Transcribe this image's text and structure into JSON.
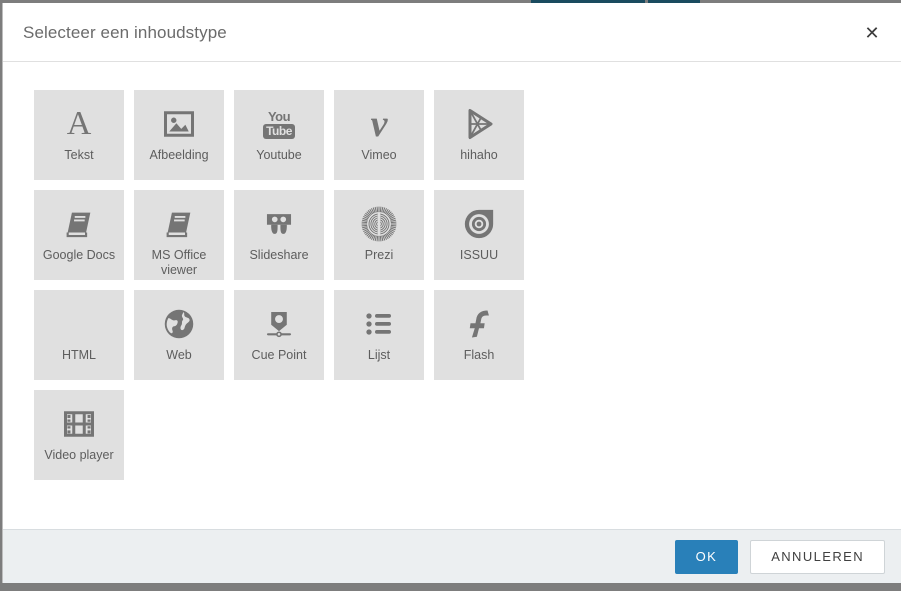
{
  "backdrop": {
    "accent_color": "#1a4b5f",
    "frame_color": "#7d7d7d"
  },
  "dialog": {
    "title": "Selecteer een inhoudstype",
    "close_label": "✕",
    "accent_color": "#2980b9",
    "tile_bg": "#e0e0e0",
    "icon_color": "#757575",
    "footer_bg": "#eceff1",
    "tiles": [
      {
        "label": "Tekst",
        "icon": "text-a-icon"
      },
      {
        "label": "Afbeelding",
        "icon": "image-icon"
      },
      {
        "label": "Youtube",
        "icon": "youtube-icon",
        "icon_text_top": "You",
        "icon_text_bottom": "Tube"
      },
      {
        "label": "Vimeo",
        "icon": "vimeo-icon",
        "icon_text": "v"
      },
      {
        "label": "hihaho",
        "icon": "hihaho-play-icon"
      },
      {
        "label": "Google Docs",
        "icon": "book-icon"
      },
      {
        "label": "MS Office viewer",
        "icon": "book-icon"
      },
      {
        "label": "Slideshare",
        "icon": "slideshare-icon"
      },
      {
        "label": "Prezi",
        "icon": "prezi-sunburst-icon"
      },
      {
        "label": "ISSUU",
        "icon": "issuu-target-icon"
      },
      {
        "label": "HTML",
        "icon": "code-brackets-icon",
        "icon_text": "</>"
      },
      {
        "label": "Web",
        "icon": "globe-icon"
      },
      {
        "label": "Cue Point",
        "icon": "cue-point-marker-icon"
      },
      {
        "label": "Lijst",
        "icon": "list-bullets-icon"
      },
      {
        "label": "Flash",
        "icon": "flash-f-icon"
      },
      {
        "label": "Video player",
        "icon": "film-strip-icon"
      }
    ],
    "footer": {
      "ok_label": "OK",
      "cancel_label": "ANNULEREN"
    }
  }
}
